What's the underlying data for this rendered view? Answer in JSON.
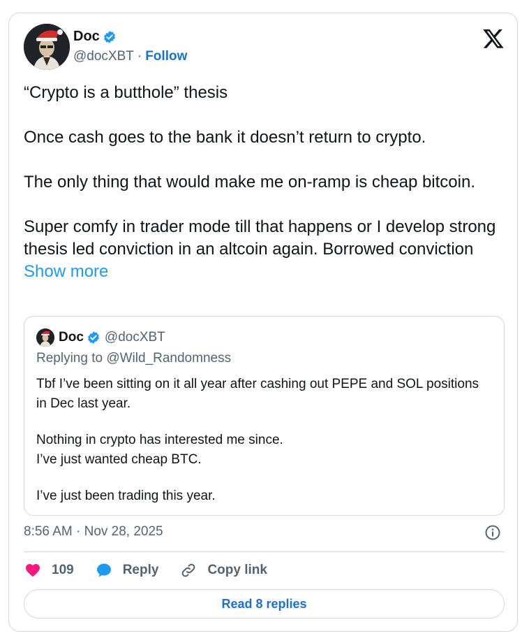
{
  "author": {
    "name": "Doc",
    "handle": "@docXBT",
    "separator": "·",
    "follow_label": "Follow"
  },
  "tweet": {
    "paragraphs": [
      "“Crypto is a butthole” thesis",
      "Once cash goes to the bank it doesn’t return to crypto.",
      "The only thing that would make me on-ramp is cheap bitcoin.",
      "Super comfy in trader mode till that happens or I develop strong thesis led conviction in an altcoin again. Borrowed conviction"
    ],
    "show_more": "Show more"
  },
  "quoted": {
    "name": "Doc",
    "handle": "@docXBT",
    "replying_to": "Replying to @Wild_Randomness",
    "paragraphs": [
      "Tbf I’ve been sitting on it all year after cashing out PEPE and SOL positions in Dec last year.",
      "Nothing in crypto has interested me since.\nI’ve just wanted cheap BTC.",
      "I’ve just been trading this year."
    ]
  },
  "meta": {
    "timestamp": "8:56 AM · Nov 28, 2025"
  },
  "actions": {
    "likes": "109",
    "reply_label": "Reply",
    "copy_label": "Copy link"
  },
  "read_replies_label": "Read 8 replies",
  "colors": {
    "verified": "#1d9bf0",
    "link": "#1d6fd8",
    "heart": "#f91880"
  }
}
